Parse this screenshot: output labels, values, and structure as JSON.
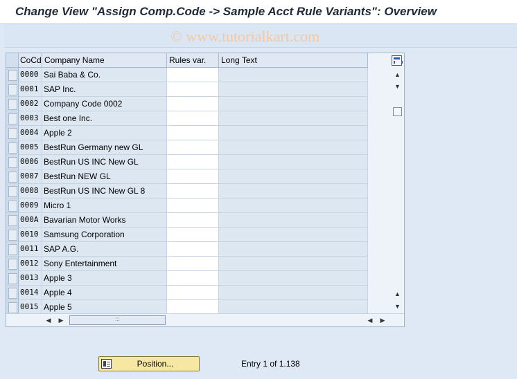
{
  "title": "Change View \"Assign Comp.Code -> Sample Acct Rule Variants\": Overview",
  "watermark": "© www.tutorialkart.com",
  "table": {
    "headers": {
      "cocd": "CoCd",
      "company_name": "Company Name",
      "rules_var": "Rules var.",
      "long_text": "Long Text"
    },
    "rows": [
      {
        "cocd": "0000",
        "name": "Sai Baba & Co.",
        "rules_var": "",
        "long_text": ""
      },
      {
        "cocd": "0001",
        "name": "SAP Inc.",
        "rules_var": "",
        "long_text": ""
      },
      {
        "cocd": "0002",
        "name": "Company Code 0002",
        "rules_var": "",
        "long_text": ""
      },
      {
        "cocd": "0003",
        "name": "Best one Inc.",
        "rules_var": "",
        "long_text": ""
      },
      {
        "cocd": "0004",
        "name": "Apple 2",
        "rules_var": "",
        "long_text": ""
      },
      {
        "cocd": "0005",
        "name": "BestRun Germany new GL",
        "rules_var": "",
        "long_text": ""
      },
      {
        "cocd": "0006",
        "name": "BestRun US INC New GL",
        "rules_var": "",
        "long_text": ""
      },
      {
        "cocd": "0007",
        "name": "BestRun NEW GL",
        "rules_var": "",
        "long_text": ""
      },
      {
        "cocd": "0008",
        "name": "BestRun US INC New GL 8",
        "rules_var": "",
        "long_text": ""
      },
      {
        "cocd": "0009",
        "name": "Micro 1",
        "rules_var": "",
        "long_text": ""
      },
      {
        "cocd": "000A",
        "name": "Bavarian Motor Works",
        "rules_var": "",
        "long_text": ""
      },
      {
        "cocd": "0010",
        "name": "Samsung Corporation",
        "rules_var": "",
        "long_text": ""
      },
      {
        "cocd": "0011",
        "name": "SAP A.G.",
        "rules_var": "",
        "long_text": ""
      },
      {
        "cocd": "0012",
        "name": "Sony Entertainment",
        "rules_var": "",
        "long_text": ""
      },
      {
        "cocd": "0013",
        "name": "Apple 3",
        "rules_var": "",
        "long_text": ""
      },
      {
        "cocd": "0014",
        "name": "Apple 4",
        "rules_var": "",
        "long_text": ""
      },
      {
        "cocd": "0015",
        "name": "Apple 5",
        "rules_var": "",
        "long_text": ""
      }
    ]
  },
  "footer": {
    "position_button": "Position...",
    "entry_info": "Entry 1 of 1.138"
  },
  "icons": {
    "table_settings": "table-settings-icon",
    "position_button_icon": "position-icon"
  },
  "colors": {
    "background": "#dfe9f5",
    "button": "#f6e7a3",
    "watermark": "#f1c9a4"
  }
}
